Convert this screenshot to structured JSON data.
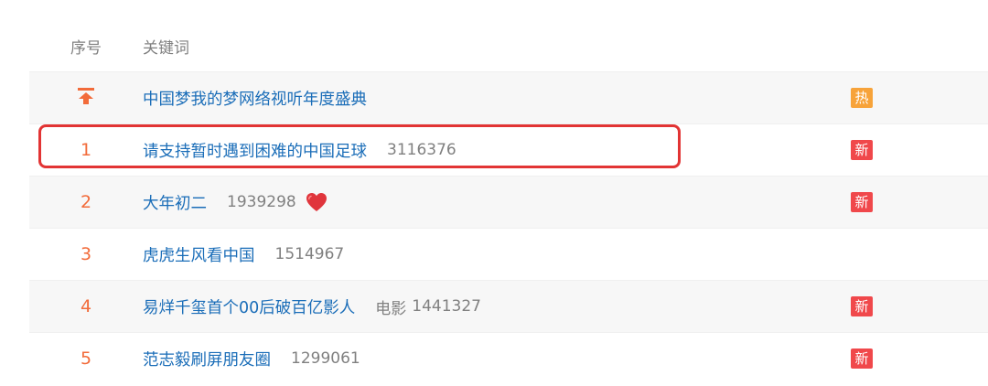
{
  "header": {
    "rank_label": "序号",
    "keyword_label": "关键词"
  },
  "pinned": {
    "icon": "pin-top-icon",
    "keyword": "中国梦我的梦网络视听年度盛典",
    "badge": "热",
    "badge_color": "#f7a33a"
  },
  "rows": [
    {
      "rank": "1",
      "keyword": "请支持暂时遇到困难的中国足球",
      "category": "",
      "count": "3116376",
      "emoji": "",
      "badge": "新",
      "badge_color": "#f0484b"
    },
    {
      "rank": "2",
      "keyword": "大年初二",
      "category": "",
      "count": "1939298",
      "emoji": "heart-icon",
      "badge": "新",
      "badge_color": "#f0484b"
    },
    {
      "rank": "3",
      "keyword": "虎虎生风看中国",
      "category": "",
      "count": "1514967",
      "emoji": "",
      "badge": "",
      "badge_color": ""
    },
    {
      "rank": "4",
      "keyword": "易烊千玺首个00后破百亿影人",
      "category": "电影",
      "count": "1441327",
      "emoji": "",
      "badge": "新",
      "badge_color": "#f0484b"
    },
    {
      "rank": "5",
      "keyword": "范志毅刷屏朋友圈",
      "category": "",
      "count": "1299061",
      "emoji": "",
      "badge": "新",
      "badge_color": "#f0484b"
    }
  ],
  "colors": {
    "link": "#1a6db8",
    "rank": "#f26b3a",
    "muted": "#808080",
    "highlight": "#e23434"
  }
}
